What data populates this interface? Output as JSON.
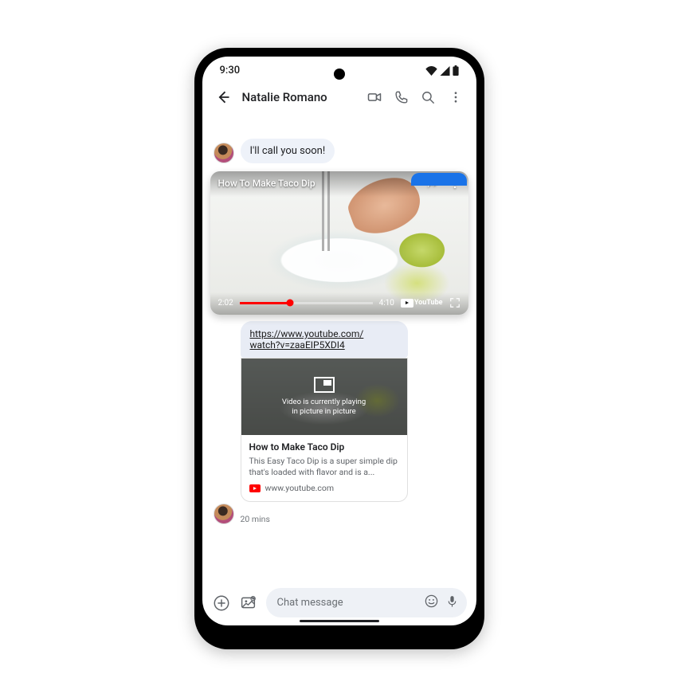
{
  "statusbar": {
    "time": "9:30"
  },
  "appbar": {
    "contact_name": "Natalie Romano"
  },
  "messages": {
    "msg1_text": "I'll call you soon!"
  },
  "pip": {
    "title": "How To Make Taco Dip",
    "elapsed": "2:02",
    "duration": "4:10",
    "provider": "YouTube"
  },
  "link_preview": {
    "url_line1": "https://www.youtube.com/",
    "url_line2": "watch?v=zaaEIP5XDI4",
    "overlay_line1": "Video is currently playing",
    "overlay_line2": "in picture in picture",
    "card_title": "How to Make Taco Dip",
    "card_desc": "This Easy Taco Dip is a super simple dip that's loaded with flavor and is a...",
    "source_domain": "www.youtube.com",
    "timestamp": "20 mins"
  },
  "compose": {
    "placeholder": "Chat message"
  }
}
